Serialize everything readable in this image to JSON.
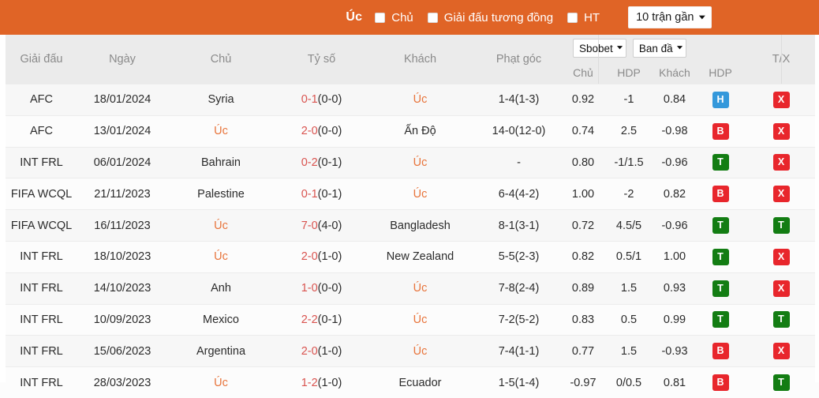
{
  "topbar": {
    "team": "Úc",
    "checkbox_home_label": "Chủ",
    "checkbox_similar_label": "Giải đấu tương đồng",
    "checkbox_ht_label": "HT",
    "matches_select": "10 trận gần",
    "caret": "⌄"
  },
  "header": {
    "league": "Giải đấu",
    "date": "Ngày",
    "home": "Chủ",
    "score": "Tỷ số",
    "away": "Khách",
    "corner": "Phạt góc",
    "bookmaker_select": "Sbobet",
    "odds_type_select": "Ban đầ",
    "sub_home": "Chủ",
    "sub_hdp1": "HDP",
    "sub_away": "Khách",
    "sub_hdp2": "HDP",
    "tx": "T/X"
  },
  "rows": [
    {
      "league": "AFC",
      "date": "18/01/2024",
      "home": "Syria",
      "home_hl": false,
      "score_main": "0-1",
      "score_ht": "(0-0)",
      "away": "Úc",
      "away_hl": true,
      "corner": "1-4(1-3)",
      "home_odd": "0.92",
      "hdp1": "-1",
      "away_odd": "0.84",
      "hdp_badge": "H",
      "hdp_badge_color": "b-blue",
      "tx_badge": "X",
      "tx_badge_color": "b-red"
    },
    {
      "league": "AFC",
      "date": "13/01/2024",
      "home": "Úc",
      "home_hl": true,
      "score_main": "2-0",
      "score_ht": "(0-0)",
      "away": "Ấn Độ",
      "away_hl": false,
      "corner": "14-0(12-0)",
      "home_odd": "0.74",
      "hdp1": "2.5",
      "away_odd": "-0.98",
      "hdp_badge": "B",
      "hdp_badge_color": "b-red",
      "tx_badge": "X",
      "tx_badge_color": "b-red"
    },
    {
      "league": "INT FRL",
      "date": "06/01/2024",
      "home": "Bahrain",
      "home_hl": false,
      "score_main": "0-2",
      "score_ht": "(0-1)",
      "away": "Úc",
      "away_hl": true,
      "corner": "-",
      "home_odd": "0.80",
      "hdp1": "-1/1.5",
      "away_odd": "-0.96",
      "hdp_badge": "T",
      "hdp_badge_color": "b-green",
      "tx_badge": "X",
      "tx_badge_color": "b-red"
    },
    {
      "league": "FIFA WCQL",
      "date": "21/11/2023",
      "home": "Palestine",
      "home_hl": false,
      "score_main": "0-1",
      "score_ht": "(0-1)",
      "away": "Úc",
      "away_hl": true,
      "corner": "6-4(4-2)",
      "home_odd": "1.00",
      "hdp1": "-2",
      "away_odd": "0.82",
      "hdp_badge": "B",
      "hdp_badge_color": "b-red",
      "tx_badge": "X",
      "tx_badge_color": "b-red"
    },
    {
      "league": "FIFA WCQL",
      "date": "16/11/2023",
      "home": "Úc",
      "home_hl": true,
      "score_main": "7-0",
      "score_ht": "(4-0)",
      "away": "Bangladesh",
      "away_hl": false,
      "corner": "8-1(3-1)",
      "home_odd": "0.72",
      "hdp1": "4.5/5",
      "away_odd": "-0.96",
      "hdp_badge": "T",
      "hdp_badge_color": "b-green",
      "tx_badge": "T",
      "tx_badge_color": "b-green"
    },
    {
      "league": "INT FRL",
      "date": "18/10/2023",
      "home": "Úc",
      "home_hl": true,
      "score_main": "2-0",
      "score_ht": "(1-0)",
      "away": "New Zealand",
      "away_hl": false,
      "corner": "5-5(2-3)",
      "home_odd": "0.82",
      "hdp1": "0.5/1",
      "away_odd": "1.00",
      "hdp_badge": "T",
      "hdp_badge_color": "b-green",
      "tx_badge": "X",
      "tx_badge_color": "b-red"
    },
    {
      "league": "INT FRL",
      "date": "14/10/2023",
      "home": "Anh",
      "home_hl": false,
      "score_main": "1-0",
      "score_ht": "(0-0)",
      "away": "Úc",
      "away_hl": true,
      "corner": "7-8(2-4)",
      "home_odd": "0.89",
      "hdp1": "1.5",
      "away_odd": "0.93",
      "hdp_badge": "T",
      "hdp_badge_color": "b-green",
      "tx_badge": "X",
      "tx_badge_color": "b-red"
    },
    {
      "league": "INT FRL",
      "date": "10/09/2023",
      "home": "Mexico",
      "home_hl": false,
      "score_main": "2-2",
      "score_ht": "(0-1)",
      "away": "Úc",
      "away_hl": true,
      "corner": "7-2(5-2)",
      "home_odd": "0.83",
      "hdp1": "0.5",
      "away_odd": "0.99",
      "hdp_badge": "T",
      "hdp_badge_color": "b-green",
      "tx_badge": "T",
      "tx_badge_color": "b-green"
    },
    {
      "league": "INT FRL",
      "date": "15/06/2023",
      "home": "Argentina",
      "home_hl": false,
      "score_main": "2-0",
      "score_ht": "(1-0)",
      "away": "Úc",
      "away_hl": true,
      "corner": "7-4(1-1)",
      "home_odd": "0.77",
      "hdp1": "1.5",
      "away_odd": "-0.93",
      "hdp_badge": "B",
      "hdp_badge_color": "b-red",
      "tx_badge": "X",
      "tx_badge_color": "b-red"
    },
    {
      "league": "INT FRL",
      "date": "28/03/2023",
      "home": "Úc",
      "home_hl": true,
      "score_main": "1-2",
      "score_ht": "(1-0)",
      "away": "Ecuador",
      "away_hl": false,
      "corner": "1-5(1-4)",
      "home_odd": "-0.97",
      "hdp1": "0/0.5",
      "away_odd": "0.81",
      "hdp_badge": "B",
      "hdp_badge_color": "b-red",
      "tx_badge": "T",
      "tx_badge_color": "b-green"
    }
  ],
  "colors": {
    "brand_orange": "#e06426",
    "team_highlight": "#e8743b",
    "score_red": "#d9534f",
    "badge_red": "#e8262c",
    "badge_green": "#137d13",
    "badge_blue": "#3498db"
  }
}
